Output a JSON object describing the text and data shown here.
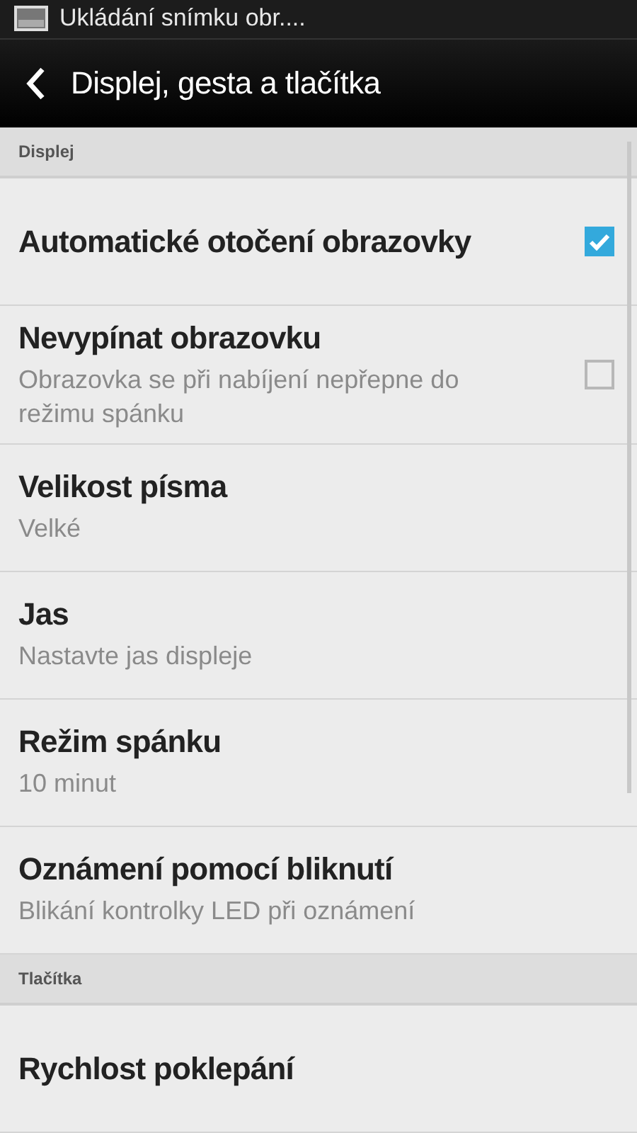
{
  "status_bar": {
    "notification": "Ukládání snímku obr...."
  },
  "header": {
    "title": "Displej, gesta a tlačítka"
  },
  "sections": [
    {
      "title": "Displej",
      "rows": [
        {
          "kind": "checkbox",
          "title": "Automatické otočení obrazovky",
          "checked": true
        },
        {
          "kind": "checkbox",
          "title": "Nevypínat obrazovku",
          "subtitle": "Obrazovka se při nabíjení nepřepne do režimu spánku",
          "checked": false
        },
        {
          "kind": "value",
          "title": "Velikost písma",
          "subtitle": "Velké"
        },
        {
          "kind": "value",
          "title": "Jas",
          "subtitle": "Nastavte jas displeje"
        },
        {
          "kind": "value",
          "title": "Režim spánku",
          "subtitle": "10 minut"
        },
        {
          "kind": "value",
          "title": "Oznámení pomocí bliknutí",
          "subtitle": "Blikání kontrolky LED při oznámení"
        }
      ]
    },
    {
      "title": "Tlačítka",
      "rows": [
        {
          "kind": "value",
          "title": "Rychlost poklepání"
        }
      ]
    }
  ]
}
